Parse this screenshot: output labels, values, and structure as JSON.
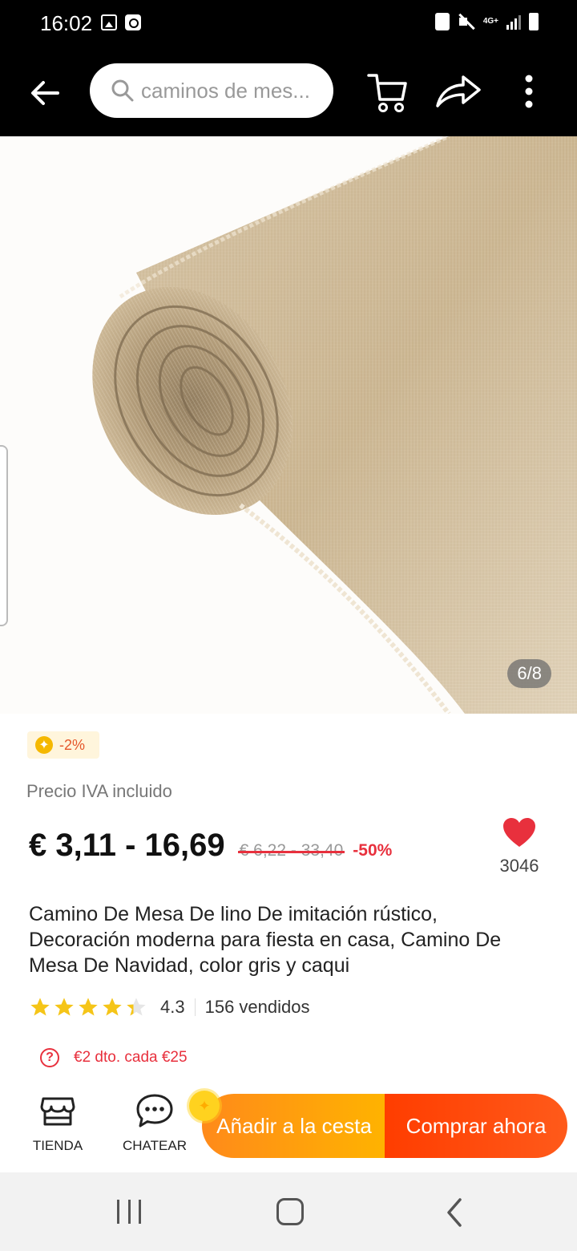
{
  "status_bar": {
    "time": "16:02",
    "network": "4G+"
  },
  "header": {
    "search_placeholder": "caminos de mes..."
  },
  "gallery": {
    "counter": "6/8"
  },
  "coins": {
    "label": "-2%"
  },
  "price": {
    "vat_label": "Precio IVA incluido",
    "current": "€ 3,11 - 16,69",
    "original": "€ 6,22 - 33,40",
    "discount": "-50%"
  },
  "wishlist": {
    "count": "3046"
  },
  "product": {
    "title": "Camino De Mesa De lino De imitación rústico, Decoración moderna para fiesta en casa, Camino De Mesa De Navidad, color gris y caqui"
  },
  "rating": {
    "value": "4.3",
    "stars": 4.3,
    "sold": "156 vendidos"
  },
  "promo": {
    "text": "€2 dto. cada €25"
  },
  "actions": {
    "store_label": "TIENDA",
    "chat_label": "CHATEAR",
    "add_to_cart": "Añadir a la cesta",
    "buy_now": "Comprar ahora"
  },
  "colors": {
    "accent_red": "#e8303d",
    "cart_orange": "#ff9a10",
    "buy_orange": "#ff4a0a",
    "star_yellow": "#f5c518"
  }
}
